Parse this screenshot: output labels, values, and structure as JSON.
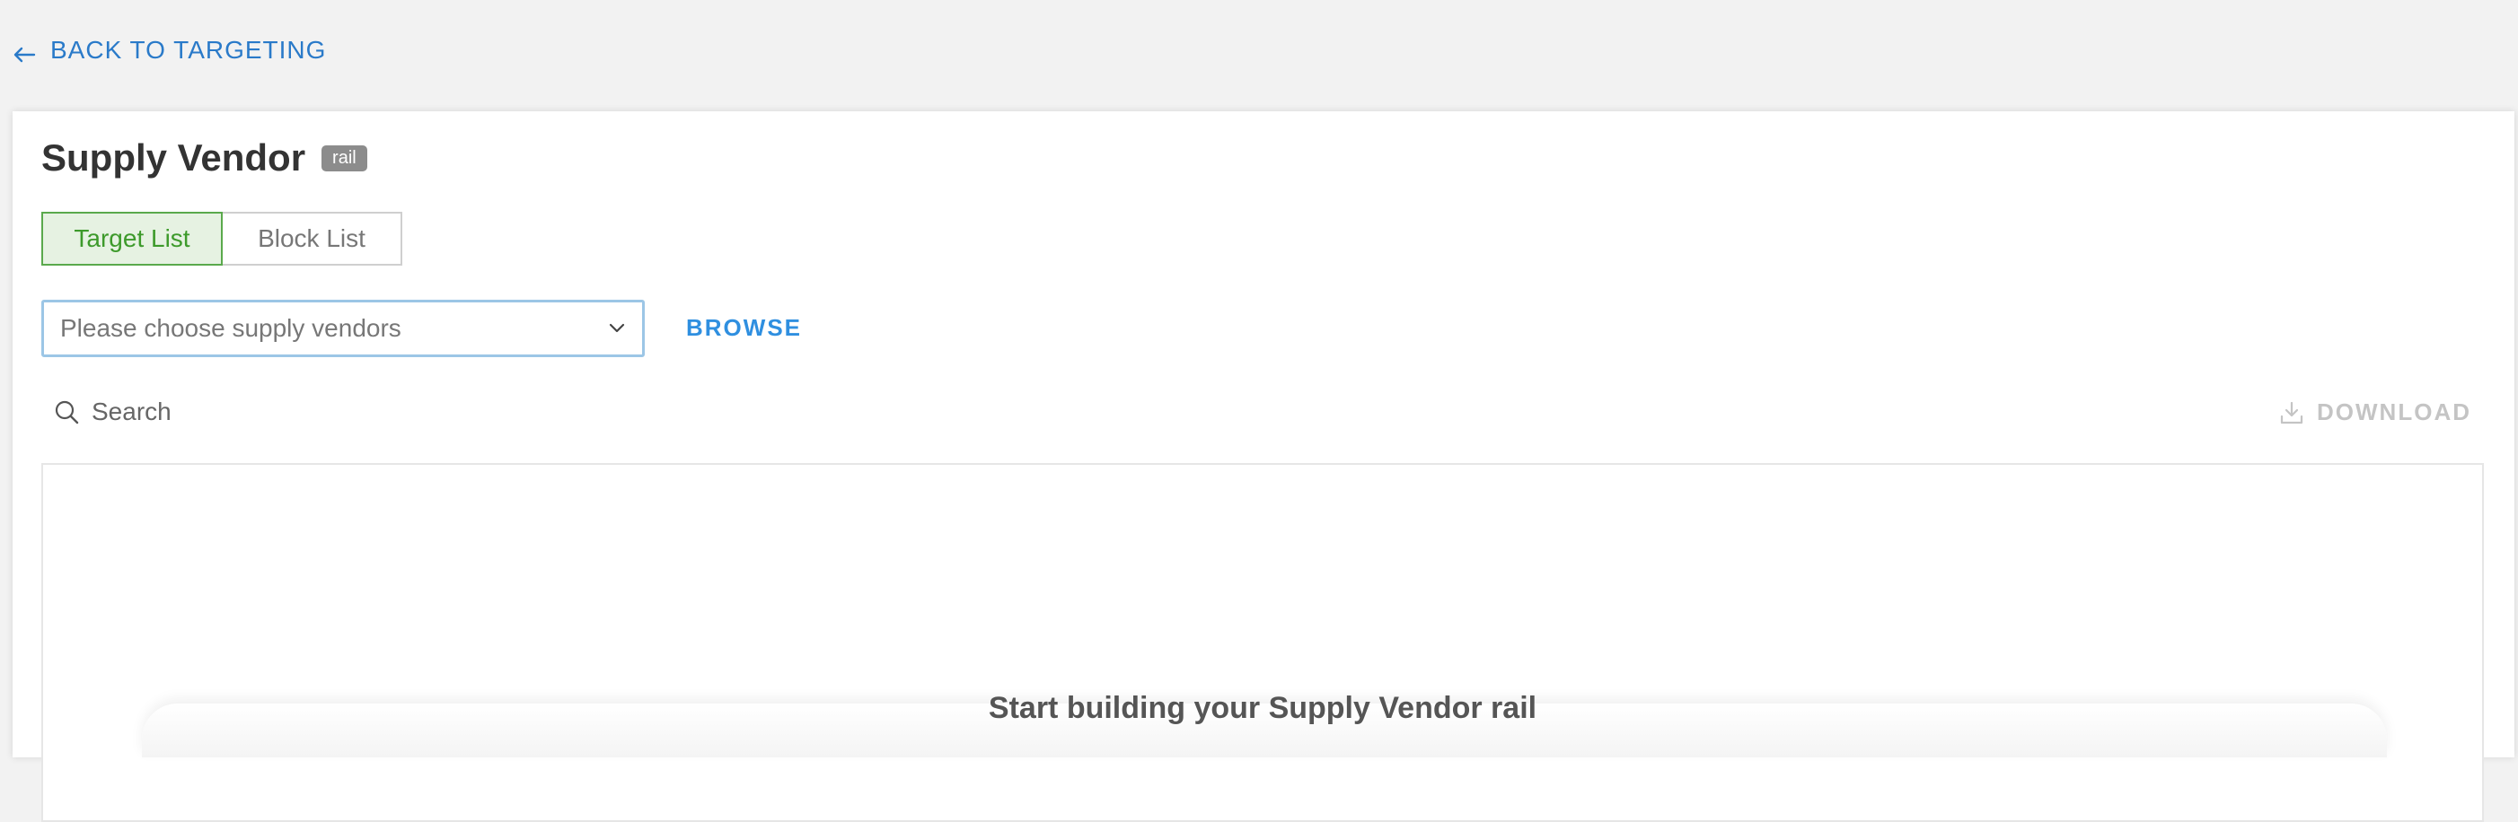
{
  "nav": {
    "back_label": "BACK TO TARGETING"
  },
  "header": {
    "title": "Supply Vendor",
    "badge": "rail"
  },
  "tabs": [
    {
      "label": "Target List",
      "active": true
    },
    {
      "label": "Block List",
      "active": false
    }
  ],
  "vendor_select": {
    "placeholder": "Please choose supply vendors"
  },
  "browse_label": "BROWSE",
  "search": {
    "placeholder": "Search"
  },
  "download_label": "DOWNLOAD",
  "empty_state": {
    "message": "Start building your Supply Vendor rail"
  },
  "colors": {
    "link_blue": "#2a7ac9",
    "browse_blue": "#2f8fe0",
    "active_green": "#3d9a2b",
    "active_bg": "#e6f2e2",
    "disabled_gray": "#c4c4c4"
  },
  "icons": {
    "back": "arrow-left-icon",
    "select": "chevron-down-icon",
    "search": "search-icon",
    "download": "download-icon"
  }
}
